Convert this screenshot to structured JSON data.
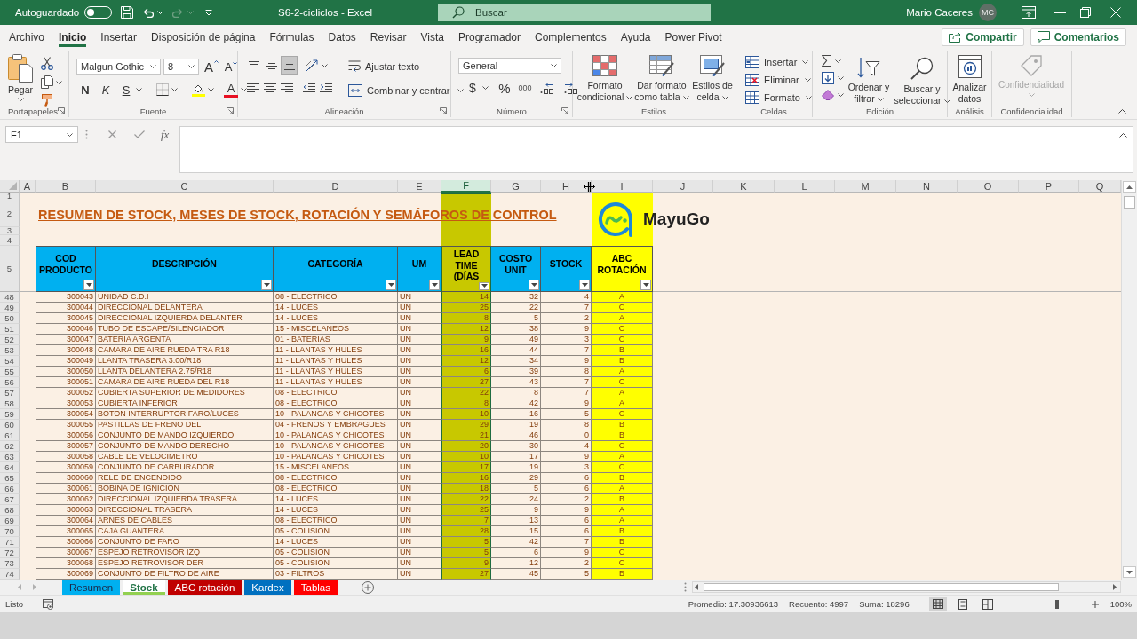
{
  "title_bar": {
    "autosave": {
      "label": "Autoguardado",
      "on": false
    },
    "redo": {
      "disabled": true
    },
    "title": "S6-2-cicliclos - Excel",
    "search": {
      "placeholder": "Buscar"
    },
    "user": {
      "name": "Mario Caceres",
      "initials": "MC"
    }
  },
  "menu": {
    "tabs": [
      {
        "label": "Archivo",
        "selected": false
      },
      {
        "label": "Inicio",
        "selected": true
      },
      {
        "label": "Insertar",
        "selected": false
      },
      {
        "label": "Disposición de página",
        "selected": false
      },
      {
        "label": "Fórmulas",
        "selected": false
      },
      {
        "label": "Datos",
        "selected": false
      },
      {
        "label": "Revisar",
        "selected": false
      },
      {
        "label": "Vista",
        "selected": false
      },
      {
        "label": "Programador",
        "selected": false
      },
      {
        "label": "Complementos",
        "selected": false
      },
      {
        "label": "Ayuda",
        "selected": false
      },
      {
        "label": "Power Pivot",
        "selected": false
      }
    ],
    "share": "Compartir",
    "comments": "Comentarios"
  },
  "ribbon": {
    "groups": [
      {
        "kind": "clipboard",
        "label": "Portapapeles",
        "paste": "Pegar"
      },
      {
        "kind": "font",
        "label": "Fuente",
        "font_name": "Malgun Gothic",
        "font_size": "8",
        "grow": "A",
        "shrink": "A",
        "bold": "N",
        "italic": "K",
        "underline": "S",
        "font_color": "A"
      },
      {
        "kind": "alignment",
        "label": "Alineación",
        "vertical": [
          {
            "selected": false
          },
          {
            "selected": false
          },
          {
            "selected": true
          }
        ],
        "wrap_text": "Ajustar texto",
        "merge": "Combinar y centrar"
      },
      {
        "kind": "number",
        "label": "Número",
        "format": "General",
        "currency": "$",
        "percent": "%",
        "thousands": "000"
      },
      {
        "kind": "styles",
        "label": "Estilos",
        "buttons": [
          [
            "Formato",
            "condicional"
          ],
          [
            "Dar formato",
            "como tabla"
          ],
          [
            "Estilos de",
            "celda"
          ]
        ]
      },
      {
        "kind": "cells",
        "label": "Celdas",
        "buttons": [
          "Insertar",
          "Eliminar",
          "Formato"
        ]
      },
      {
        "kind": "editing",
        "label": "Edición",
        "buttons": [
          [
            "Ordenar y",
            "filtrar"
          ],
          [
            "Buscar y",
            "seleccionar"
          ]
        ]
      },
      {
        "kind": "analysis",
        "label": "Análisis",
        "button": [
          "Analizar",
          "datos"
        ]
      },
      {
        "kind": "sensitivity",
        "label": "Confidencialidad",
        "button": [
          "Confidencialidad"
        ],
        "disabled": true
      }
    ]
  },
  "formula_bar": {
    "name_box": "F1",
    "function": "fx"
  },
  "sheet": {
    "columns": [
      {
        "label": "A",
        "selected": false
      },
      {
        "label": "B",
        "selected": false
      },
      {
        "label": "C",
        "selected": false
      },
      {
        "label": "D",
        "selected": false
      },
      {
        "label": "E",
        "selected": false
      },
      {
        "label": "F",
        "selected": true
      },
      {
        "label": "G",
        "selected": false
      },
      {
        "label": "H",
        "selected": false
      },
      {
        "label": "I",
        "selected": false
      },
      {
        "label": "J",
        "selected": false
      },
      {
        "label": "K",
        "selected": false
      },
      {
        "label": "L",
        "selected": false
      },
      {
        "label": "M",
        "selected": false
      },
      {
        "label": "N",
        "selected": false
      },
      {
        "label": "O",
        "selected": false
      },
      {
        "label": "P",
        "selected": false
      },
      {
        "label": "Q",
        "selected": false
      }
    ],
    "frozen_rows": [
      "1",
      "2",
      "3",
      "4",
      "5"
    ],
    "title": "RESUMEN DE STOCK, MESES DE STOCK, ROTACIÓN Y SEMÁFOROS DE CONTROL",
    "logo": "MayuGo",
    "table": {
      "columns": [
        {
          "label": "COD PRODUCTO",
          "color": "#00b0f0",
          "highlight": false
        },
        {
          "label": "DESCRIPCIÓN",
          "color": "#00b0f0",
          "highlight": false
        },
        {
          "label": "CATEGORÍA",
          "color": "#00b0f0",
          "highlight": false
        },
        {
          "label": "UM",
          "color": "#00b0f0",
          "highlight": false
        },
        {
          "label": "LEAD TIME (DÍAS",
          "color": "#c8c800",
          "highlight": true
        },
        {
          "label": "COSTO UNIT",
          "color": "#00b0f0",
          "highlight": false
        },
        {
          "label": "STOCK",
          "color": "#00b0f0",
          "highlight": false
        },
        {
          "label": "ABC ROTACIÓN",
          "color": "#ffff00",
          "highlight": true
        }
      ],
      "rows": [
        {
          "row": "48",
          "cells": [
            "300043",
            "UNIDAD C.D.I",
            "08 - ELECTRICO",
            "UN",
            "14",
            "32",
            "4",
            "A"
          ]
        },
        {
          "row": "49",
          "cells": [
            "300044",
            "DIRECCIONAL DELANTERA",
            "14 - LUCES",
            "UN",
            "25",
            "22",
            "7",
            "C"
          ]
        },
        {
          "row": "50",
          "cells": [
            "300045",
            "DIRECCIONAL IZQUIERDA DELANTER",
            "14 - LUCES",
            "UN",
            "8",
            "5",
            "2",
            "A"
          ]
        },
        {
          "row": "51",
          "cells": [
            "300046",
            "TUBO DE ESCAPE/SILENCIADOR",
            "15 - MISCELANEOS",
            "UN",
            "12",
            "38",
            "9",
            "C"
          ]
        },
        {
          "row": "52",
          "cells": [
            "300047",
            "BATERIA ARGENTA",
            "01 - BATERIAS",
            "UN",
            "9",
            "49",
            "3",
            "C"
          ]
        },
        {
          "row": "53",
          "cells": [
            "300048",
            "CAMARA DE AIRE RUEDA TRA R18",
            "11 - LLANTAS Y HULES",
            "UN",
            "16",
            "44",
            "7",
            "B"
          ]
        },
        {
          "row": "54",
          "cells": [
            "300049",
            "LLANTA TRASERA 3.00/R18",
            "11 - LLANTAS Y HULES",
            "UN",
            "12",
            "34",
            "9",
            "B"
          ]
        },
        {
          "row": "55",
          "cells": [
            "300050",
            "LLANTA DELANTERA 2.75/R18",
            "11 - LLANTAS Y HULES",
            "UN",
            "6",
            "39",
            "8",
            "A"
          ]
        },
        {
          "row": "56",
          "cells": [
            "300051",
            "CAMARA DE AIRE RUEDA DEL R18",
            "11 - LLANTAS Y HULES",
            "UN",
            "27",
            "43",
            "7",
            "C"
          ]
        },
        {
          "row": "57",
          "cells": [
            "300052",
            "CUBIERTA SUPERIOR DE MEDIDORES",
            "08 - ELECTRICO",
            "UN",
            "22",
            "8",
            "7",
            "A"
          ]
        },
        {
          "row": "58",
          "cells": [
            "300053",
            "CUBIERTA INFERIOR",
            "08 - ELECTRICO",
            "UN",
            "8",
            "42",
            "9",
            "A"
          ]
        },
        {
          "row": "59",
          "cells": [
            "300054",
            "BOTON INTERRUPTOR FARO/LUCES",
            "10 - PALANCAS Y CHICOTES",
            "UN",
            "10",
            "16",
            "5",
            "C"
          ]
        },
        {
          "row": "60",
          "cells": [
            "300055",
            "PASTILLAS DE FRENO DEL",
            "04 - FRENOS Y EMBRAGUES",
            "UN",
            "29",
            "19",
            "8",
            "B"
          ]
        },
        {
          "row": "61",
          "cells": [
            "300056",
            "CONJUNTO DE MANDO IZQUIERDO",
            "10 - PALANCAS Y CHICOTES",
            "UN",
            "21",
            "46",
            "0",
            "B"
          ]
        },
        {
          "row": "62",
          "cells": [
            "300057",
            "CONJUNTO DE MANDO DERECHO",
            "10 - PALANCAS Y CHICOTES",
            "UN",
            "20",
            "30",
            "4",
            "C"
          ]
        },
        {
          "row": "63",
          "cells": [
            "300058",
            "CABLE DE VELOCIMETRO",
            "10 - PALANCAS Y CHICOTES",
            "UN",
            "10",
            "17",
            "9",
            "A"
          ]
        },
        {
          "row": "64",
          "cells": [
            "300059",
            "CONJUNTO DE CARBURADOR",
            "15 - MISCELANEOS",
            "UN",
            "17",
            "19",
            "3",
            "C"
          ]
        },
        {
          "row": "65",
          "cells": [
            "300060",
            "RELE DE ENCENDIDO",
            "08 - ELECTRICO",
            "UN",
            "16",
            "29",
            "6",
            "B"
          ]
        },
        {
          "row": "66",
          "cells": [
            "300061",
            "BOBINA DE IGNICION",
            "08 - ELECTRICO",
            "UN",
            "18",
            "5",
            "6",
            "A"
          ]
        },
        {
          "row": "67",
          "cells": [
            "300062",
            "DIRECCIONAL IZQUIERDA TRASERA",
            "14 - LUCES",
            "UN",
            "22",
            "24",
            "2",
            "B"
          ]
        },
        {
          "row": "68",
          "cells": [
            "300063",
            "DIRECCIONAL TRASERA",
            "14 - LUCES",
            "UN",
            "25",
            "9",
            "9",
            "A"
          ]
        },
        {
          "row": "69",
          "cells": [
            "300064",
            "ARNES DE CABLES",
            "08 - ELECTRICO",
            "UN",
            "7",
            "13",
            "6",
            "A"
          ]
        },
        {
          "row": "70",
          "cells": [
            "300065",
            "CAJA GUANTERA",
            "05 - COLISION",
            "UN",
            "28",
            "15",
            "6",
            "B"
          ]
        },
        {
          "row": "71",
          "cells": [
            "300066",
            "CONJUNTO DE FARO",
            "14 - LUCES",
            "UN",
            "5",
            "42",
            "7",
            "B"
          ]
        },
        {
          "row": "72",
          "cells": [
            "300067",
            "ESPEJO RETROVISOR IZQ",
            "05 - COLISION",
            "UN",
            "5",
            "6",
            "9",
            "C"
          ]
        },
        {
          "row": "73",
          "cells": [
            "300068",
            "ESPEJO RETROVISOR DER",
            "05 - COLISION",
            "UN",
            "9",
            "12",
            "2",
            "C"
          ]
        },
        {
          "row": "74",
          "cells": [
            "300069",
            "CONJUNTO DE FILTRO DE AIRE",
            "03 - FILTROS",
            "UN",
            "27",
            "45",
            "5",
            "B"
          ]
        }
      ]
    }
  },
  "sheet_tabs": [
    {
      "label": "Resumen",
      "color": "#00b0f0",
      "selected": false
    },
    {
      "label": "Stock",
      "color": "#92d050",
      "selected": true
    },
    {
      "label": "ABC rotación",
      "color": "#c00000",
      "selected": false
    },
    {
      "label": "Kardex",
      "color": "#0070c0",
      "selected": false
    },
    {
      "label": "Tablas",
      "color": "#ff0000",
      "selected": false
    }
  ],
  "status_bar": {
    "status": "Listo",
    "stats": [
      "Promedio: 17.30936613",
      "Recuento: 4997",
      "Suma: 18296"
    ],
    "views": [
      {
        "selected": true
      },
      {
        "selected": false
      },
      {
        "selected": false
      }
    ],
    "zoom": {
      "level": 0.5,
      "label": "100%"
    }
  }
}
